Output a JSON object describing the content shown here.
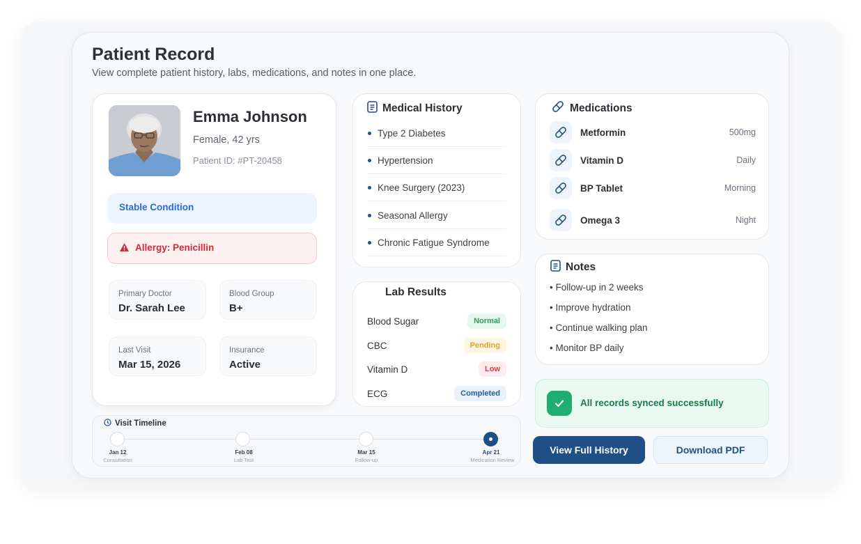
{
  "header": {
    "title": "Patient Record",
    "subtitle": "View complete patient history, labs, medications, and notes in one place."
  },
  "patient": {
    "name": "Emma Johnson",
    "gender_age": "Female, 42 yrs",
    "patient_id": "Patient ID: #PT-20458",
    "condition": "Stable Condition",
    "allergy": "Allergy: Penicillin",
    "details": [
      {
        "label": "Primary Doctor",
        "value": "Dr. Sarah Lee"
      },
      {
        "label": "Blood Group",
        "value": "B+"
      },
      {
        "label": "Last Visit",
        "value": "Mar 15, 2026"
      },
      {
        "label": "Insurance",
        "value": "Active"
      }
    ]
  },
  "history": {
    "title": "Medical History",
    "items": [
      "Type 2 Diabetes",
      "Hypertension",
      "Knee Surgery (2023)",
      "Seasonal Allergy",
      "Chronic Fatigue Syndrome"
    ]
  },
  "labs": {
    "title": "Lab Results",
    "rows": [
      {
        "name": "Blood Sugar",
        "status": "Normal"
      },
      {
        "name": "CBC",
        "status": "Pending"
      },
      {
        "name": "Vitamin D",
        "status": "Low"
      },
      {
        "name": "ECG",
        "status": "Completed"
      }
    ]
  },
  "medications": {
    "title": "Medications",
    "items": [
      {
        "name": "Metformin",
        "dose": "500mg"
      },
      {
        "name": "Vitamin D",
        "dose": "Daily"
      },
      {
        "name": "BP Tablet",
        "dose": "Morning"
      },
      {
        "name": "Omega 3",
        "dose": "Night"
      }
    ]
  },
  "notes": {
    "title": "Notes",
    "items": [
      "• Follow-up in 2 weeks",
      "• Improve hydration",
      "• Continue walking plan",
      "• Monitor BP daily"
    ]
  },
  "sync": {
    "message": "All records synced successfully"
  },
  "actions": {
    "primary": "View Full History",
    "secondary": "Download PDF"
  },
  "timeline": {
    "title": "Visit Timeline",
    "events": [
      {
        "date": "Jan 12",
        "label": "Consultation"
      },
      {
        "date": "Feb 08",
        "label": "Lab Test"
      },
      {
        "date": "Mar 15",
        "label": "Follow-up"
      },
      {
        "date": "Apr 21",
        "label": "Medication Review"
      }
    ]
  },
  "colors": {
    "accent": "#1f4f86",
    "success": "#1fae71",
    "danger": "#d12b36",
    "info": "#2c6bd0"
  }
}
